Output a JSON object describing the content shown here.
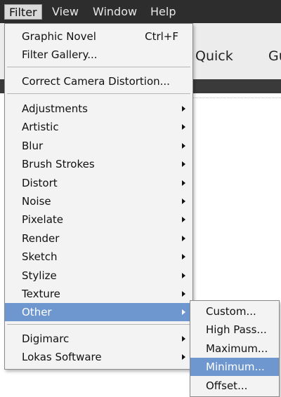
{
  "menubar": {
    "items": [
      {
        "label": "Filter"
      },
      {
        "label": "View"
      },
      {
        "label": "Window"
      },
      {
        "label": "Help"
      }
    ]
  },
  "background": {
    "tabs": [
      {
        "label": "Quick"
      },
      {
        "label": "Gu"
      }
    ]
  },
  "filter_menu": {
    "graphic_novel": {
      "label": "Graphic Novel",
      "shortcut": "Ctrl+F"
    },
    "filter_gallery": {
      "label": "Filter Gallery..."
    },
    "correct_camera": {
      "label": "Correct Camera Distortion..."
    },
    "adjustments": {
      "label": "Adjustments"
    },
    "artistic": {
      "label": "Artistic"
    },
    "blur": {
      "label": "Blur"
    },
    "brush_strokes": {
      "label": "Brush Strokes"
    },
    "distort": {
      "label": "Distort"
    },
    "noise": {
      "label": "Noise"
    },
    "pixelate": {
      "label": "Pixelate"
    },
    "render": {
      "label": "Render"
    },
    "sketch": {
      "label": "Sketch"
    },
    "stylize": {
      "label": "Stylize"
    },
    "texture": {
      "label": "Texture"
    },
    "other": {
      "label": "Other"
    },
    "digimarc": {
      "label": "Digimarc"
    },
    "lokas": {
      "label": "Lokas Software"
    }
  },
  "other_submenu": {
    "items": [
      {
        "label": "Custom..."
      },
      {
        "label": "High Pass..."
      },
      {
        "label": "Maximum..."
      },
      {
        "label": "Minimum..."
      },
      {
        "label": "Offset..."
      }
    ]
  },
  "colors": {
    "menubar_bg": "#2d2d2d",
    "highlight": "#6f97cf",
    "menu_bg": "#f3f3f3"
  }
}
